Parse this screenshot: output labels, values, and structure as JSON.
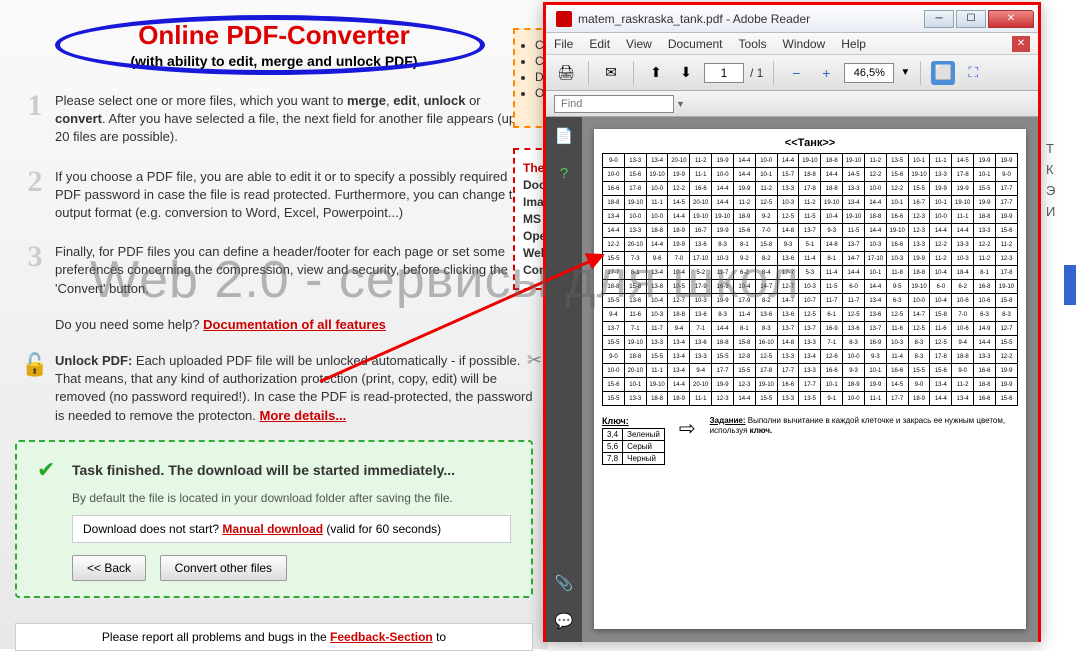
{
  "header": {
    "title": "Online PDF-Converter",
    "subtitle": "(with ability to edit, merge and unlock PDF)"
  },
  "steps": [
    {
      "num": "1",
      "pre": "Please select one or more files, which you want to ",
      "bold1": "merge",
      "sep1": ", ",
      "bold2": "edit",
      "sep2": ", ",
      "bold3": "unlock",
      "sep3": " or ",
      "bold4": "convert",
      "post": ". After you have selected a file, the next field for another file appears (up to 20 files are possible)."
    },
    {
      "num": "2",
      "text": "If you choose a PDF file, you are able to edit it or to specify a possibly required PDF password in case the file is read protected. Furthermore, you can change the output format (e.g. conversion to Word, Excel, Powerpoint...)"
    },
    {
      "num": "3",
      "text": "Finally, for PDF files you can define a header/footer for each page or set some preferences concerning the compression, view and security, before clicking the 'Convert' button.",
      "help_pre": "Do you need some help? ",
      "help_link": "Documentation of all features"
    }
  ],
  "unlock": {
    "label": "Unlock PDF:",
    "text": " Each uploaded PDF file will be unlocked automatically - if possible. That means, that any kind of authorization protection (print, copy, edit) will be removed (no password required!). In case the PDF is read-protected, the password is needed to remove the protecton. ",
    "link": "More details..."
  },
  "task": {
    "title": "Task finished. The download will be started immediately...",
    "subtitle": "By default the file is located in your download folder after saving the file.",
    "download_pre": "Download does not start? ",
    "download_link": "Manual download",
    "download_post": " (valid for 60 seconds)",
    "btn_back": "<< Back",
    "btn_convert": "Convert other files"
  },
  "report": {
    "pre": "Please report all problems and bugs in the ",
    "link": "Feedback-Section",
    "post": " to"
  },
  "orange_list": [
    "Co",
    "Co",
    "Do",
    "Op"
  ],
  "red_box": {
    "title": "The",
    "items": [
      "Docu",
      "Imag",
      "MS O",
      "Ope",
      "Web",
      "Cont"
    ]
  },
  "reader": {
    "title": "matem_raskraska_tank.pdf - Adobe Reader",
    "menu": [
      "File",
      "Edit",
      "View",
      "Document",
      "Tools",
      "Window",
      "Help"
    ],
    "page_current": "1",
    "page_total": "/ 1",
    "zoom": "46,5%",
    "find_placeholder": "Find"
  },
  "pdf": {
    "title": "<<Танк>>",
    "key_label": "Ключ:",
    "key_rows": [
      [
        "3,4",
        "Зеленый"
      ],
      [
        "5,6",
        "Серый"
      ],
      [
        "7,8",
        "Черный"
      ]
    ],
    "task_label": "Задание:",
    "task_text": " Выполни вычитание в каждой клеточке и закрась ее нужным цветом, используя ",
    "task_bold": "ключ."
  },
  "grid": [
    [
      "9-0",
      "13-3",
      "13-4",
      "20-10",
      "11-2",
      "19-9",
      "14-4",
      "10-0",
      "14-4",
      "19-10",
      "18-8",
      "19-10",
      "11-2",
      "13-5",
      "10-1",
      "11-1",
      "14-5",
      "19-9",
      "19-9"
    ],
    [
      "10-0",
      "15-6",
      "19-10",
      "19-9",
      "11-1",
      "10-0",
      "14-4",
      "10-1",
      "15-7",
      "18-8",
      "14-4",
      "14-5",
      "12-2",
      "15-6",
      "19-10",
      "13-3",
      "17-8",
      "10-1",
      "9-0"
    ],
    [
      "16-6",
      "17-8",
      "10-0",
      "12-2",
      "16-6",
      "14-4",
      "19-9",
      "11-2",
      "13-3",
      "17-8",
      "18-8",
      "13-3",
      "10-0",
      "12-2",
      "15-5",
      "19-9",
      "19-9",
      "15-5",
      "17-7"
    ],
    [
      "18-8",
      "19-10",
      "11-1",
      "14-5",
      "20-10",
      "14-4",
      "11-2",
      "12-5",
      "10-3",
      "11-2",
      "19-10",
      "13-4",
      "14-4",
      "10-1",
      "16-7",
      "10-1",
      "19-10",
      "19-9",
      "17-7"
    ],
    [
      "13-4",
      "10-0",
      "10-0",
      "14-4",
      "19-10",
      "19-10",
      "18-9",
      "9-2",
      "12-5",
      "11-5",
      "10-4",
      "19-10",
      "18-8",
      "16-6",
      "12-3",
      "10-0",
      "11-1",
      "18-8",
      "19-9"
    ],
    [
      "14-4",
      "13-3",
      "18-8",
      "18-9",
      "16-7",
      "19-9",
      "15-6",
      "7-0",
      "14-8",
      "13-7",
      "9-3",
      "11-5",
      "14-4",
      "19-10",
      "12-3",
      "14-4",
      "14-4",
      "13-3",
      "15-6"
    ],
    [
      "12-2",
      "20-10",
      "14-4",
      "19-9",
      "13-6",
      "8-3",
      "8-1",
      "15-8",
      "9-3",
      "5-1",
      "14-8",
      "13-7",
      "10-3",
      "16-6",
      "13-3",
      "12-2",
      "13-3",
      "12-2",
      "11-2"
    ],
    [
      "15-5",
      "7-3",
      "9-6",
      "7-0",
      "17-10",
      "10-3",
      "9-2",
      "8-2",
      "13-6",
      "11-4",
      "8-1",
      "14-7",
      "17-10",
      "10-3",
      "19-9",
      "11-2",
      "10-3",
      "11-2",
      "12-3"
    ],
    [
      "17-7",
      "8-1",
      "13-4",
      "10-4",
      "5-2",
      "11-7",
      "6-2",
      "8-4",
      "17-7",
      "5-3",
      "11-4",
      "14-4",
      "10-1",
      "11-8",
      "18-8",
      "10-4",
      "18-4",
      "8-1",
      "17-8"
    ],
    [
      "18-8",
      "15-8",
      "13-8",
      "10-5",
      "17-9",
      "16-9",
      "10-4",
      "14-7",
      "12-7",
      "10-3",
      "11-5",
      "6-0",
      "14-4",
      "9-5",
      "19-10",
      "6-0",
      "6-2",
      "16-8",
      "19-10"
    ],
    [
      "15-5",
      "13-6",
      "10-4",
      "12-7",
      "10-3",
      "19-9",
      "17-9",
      "8-2",
      "14-7",
      "10-7",
      "11-7",
      "11-7",
      "13-4",
      "6-3",
      "10-0",
      "10-4",
      "10-6",
      "10-6",
      "15-8"
    ],
    [
      "9-4",
      "11-6",
      "10-3",
      "18-8",
      "13-6",
      "8-3",
      "11-4",
      "13-6",
      "13-6",
      "12-5",
      "6-1",
      "12-5",
      "13-6",
      "12-5",
      "14-7",
      "15-8",
      "7-0",
      "6-3",
      "8-3"
    ],
    [
      "13-7",
      "7-1",
      "11-7",
      "9-4",
      "7-1",
      "14-4",
      "8-1",
      "8-3",
      "13-7",
      "13-7",
      "16-9",
      "13-6",
      "13-7",
      "11-6",
      "12-5",
      "11-6",
      "10-6",
      "14-9",
      "12-7"
    ],
    [
      "15-5",
      "19-10",
      "13-3",
      "13-4",
      "13-6",
      "18-8",
      "15-8",
      "16-10",
      "14-8",
      "13-3",
      "7-1",
      "8-3",
      "16-9",
      "10-3",
      "8-3",
      "12-5",
      "9-4",
      "14-4",
      "15-5"
    ],
    [
      "9-0",
      "18-8",
      "15-5",
      "13-4",
      "13-3",
      "15-5",
      "12-8",
      "12-5",
      "13-3",
      "13-4",
      "12-6",
      "10-0",
      "9-3",
      "11-4",
      "8-3",
      "17-8",
      "18-8",
      "13-3",
      "12-2"
    ],
    [
      "10-0",
      "20-10",
      "11-1",
      "13-4",
      "9-4",
      "17-7",
      "15-5",
      "17-8",
      "17-7",
      "13-3",
      "16-6",
      "9-3",
      "10-1",
      "16-6",
      "15-5",
      "15-6",
      "9-0",
      "16-6",
      "19-9"
    ],
    [
      "15-6",
      "10-1",
      "19-10",
      "14-4",
      "20-10",
      "19-9",
      "12-3",
      "19-10",
      "16-6",
      "17-7",
      "10-1",
      "18-9",
      "19-9",
      "14-5",
      "9-0",
      "13-4",
      "11-2",
      "18-8",
      "19-9"
    ],
    [
      "15-5",
      "13-3",
      "18-8",
      "18-9",
      "11-1",
      "12-3",
      "14-4",
      "15-5",
      "13-3",
      "13-5",
      "9-1",
      "10-0",
      "11-1",
      "17-7",
      "18-9",
      "14-4",
      "13-4",
      "16-6",
      "15-6"
    ]
  ],
  "watermark": "Web 2.0 - сервисы для школ",
  "right_letters": [
    "Т",
    "К",
    "Э",
    "И"
  ]
}
